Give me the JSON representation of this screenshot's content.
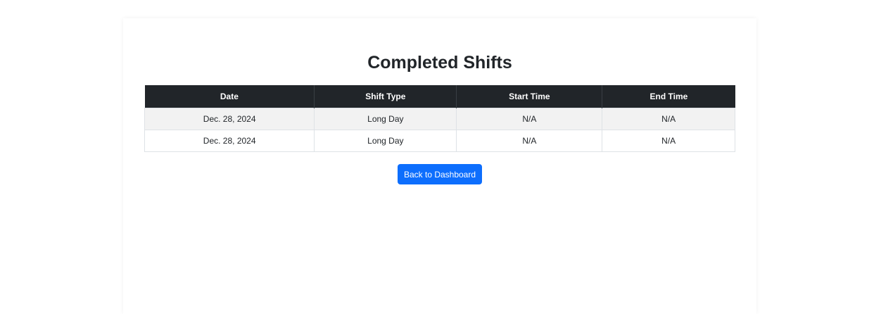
{
  "page": {
    "title": "Completed Shifts"
  },
  "table": {
    "headers": [
      "Date",
      "Shift Type",
      "Start Time",
      "End Time"
    ],
    "rows": [
      [
        "Dec. 28, 2024",
        "Long Day",
        "N/A",
        "N/A"
      ],
      [
        "Dec. 28, 2024",
        "Long Day",
        "N/A",
        "N/A"
      ]
    ]
  },
  "actions": {
    "back_label": "Back to Dashboard"
  },
  "colors": {
    "header_bg": "#212529",
    "button_bg": "#0d6efd",
    "stripe_bg": "#f2f2f2"
  }
}
